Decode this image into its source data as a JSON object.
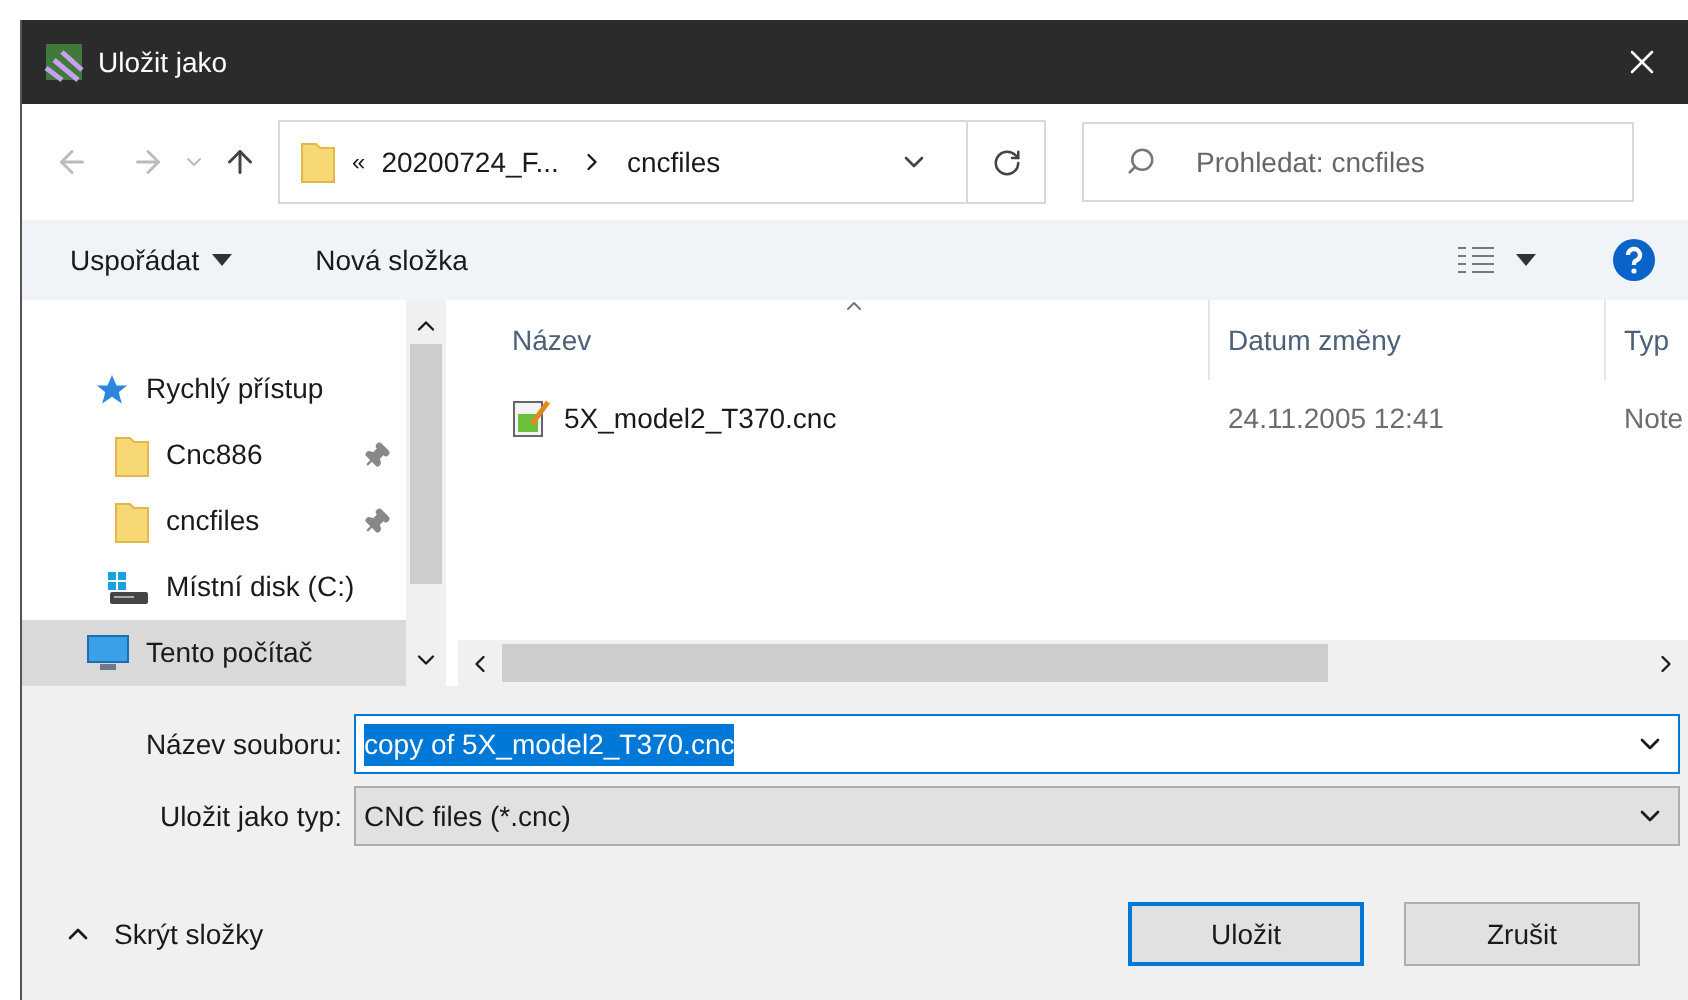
{
  "window": {
    "title": "Uložit jako"
  },
  "address_bar": {
    "overflow": "«",
    "crumbs": [
      "20200724_F...",
      "cncfiles"
    ]
  },
  "search": {
    "placeholder": "Prohledat: cncfiles"
  },
  "toolbar": {
    "organize": "Uspořádat",
    "new_folder": "Nová složka"
  },
  "sidebar": {
    "items": [
      {
        "label": "Rychlý přístup",
        "kind": "quick",
        "selected": false,
        "children": [
          {
            "label": "Cnc886",
            "kind": "folder",
            "pinned": true,
            "selected": false
          },
          {
            "label": "cncfiles",
            "kind": "folder",
            "pinned": true,
            "selected": false
          },
          {
            "label": "Místní disk (C:)",
            "kind": "drive",
            "pinned": false,
            "selected": false
          }
        ]
      },
      {
        "label": "Tento počítač",
        "kind": "computer",
        "selected": true
      }
    ]
  },
  "file_list": {
    "columns": [
      "Název",
      "Datum změny",
      "Typ"
    ],
    "rows": [
      {
        "name": "5X_model2_T370.cnc",
        "date": "24.11.2005 12:41",
        "type": "Note",
        "selected": false
      }
    ]
  },
  "file_name": {
    "label": "Název souboru:",
    "value": "copy of 5X_model2_T370.cnc",
    "text_selected": true
  },
  "file_type": {
    "label": "Uložit jako typ:",
    "value": "CNC files (*.cnc)"
  },
  "hide_folders": "Skrýt složky",
  "buttons": [
    {
      "label": "Uložit",
      "default": true
    },
    {
      "label": "Zrušit",
      "default": false
    }
  ]
}
